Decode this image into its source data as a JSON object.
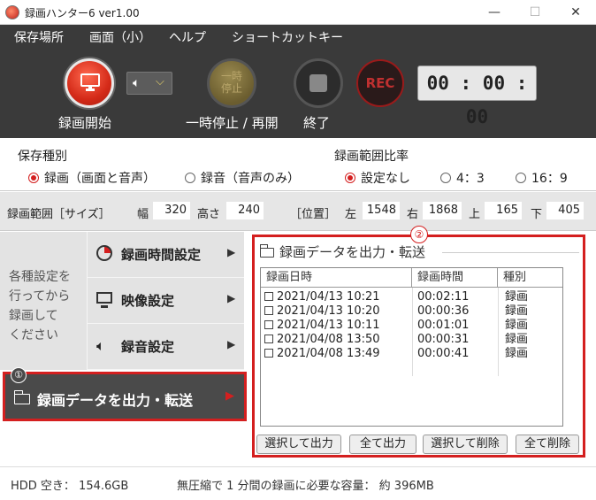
{
  "window": {
    "title": "録画ハンター6 ver1.00",
    "minimize": "—",
    "maximize": "☐",
    "close": "✕"
  },
  "menu": [
    "保存場所",
    "画面（小）",
    "ヘルプ",
    "ショートカットキー"
  ],
  "toolbar": {
    "rec_start_label": "録画開始",
    "pause_button_text": "一時\n停止",
    "pause_label": "一時停止 / 再開",
    "stop_label": "終了",
    "rec_badge": "REC",
    "timer": "00 : 00 : 00",
    "audio_icon": "speaker-icon",
    "accent_color": "#d41f1f"
  },
  "save_type": {
    "title": "保存種別",
    "options": [
      "録画（画面と音声）",
      "録音（音声のみ）"
    ],
    "selected": 0
  },
  "ratio": {
    "title": "録画範囲比率",
    "options": [
      "設定なし",
      "4：3",
      "16：9"
    ],
    "selected": 0
  },
  "range": {
    "label": "録画範囲［サイズ］",
    "width_label": "幅",
    "width": "320",
    "height_label": "高さ",
    "height": "240",
    "position_label": "［位置］",
    "left_label": "左",
    "left": "1548",
    "right_label": "右",
    "right": "1868",
    "top_label": "上",
    "top": "165",
    "bottom_label": "下",
    "bottom": "405"
  },
  "left_info": "各種設定を\n行ってから\n録画して\nください",
  "nav": {
    "time": "録画時間設定",
    "video": "映像設定",
    "audio": "録音設定",
    "export": "録画データを出力・転送",
    "badge1": "①"
  },
  "panel": {
    "badge2": "②",
    "title": "録画データを出力・転送",
    "columns": [
      "録画日時",
      "録画時間",
      "種別"
    ],
    "rows": [
      {
        "date": "2021/04/13 10:21",
        "duration": "00:02:11",
        "kind": "録画"
      },
      {
        "date": "2021/04/13 10:20",
        "duration": "00:00:36",
        "kind": "録画"
      },
      {
        "date": "2021/04/13 10:11",
        "duration": "00:01:01",
        "kind": "録画"
      },
      {
        "date": "2021/04/08 13:50",
        "duration": "00:00:31",
        "kind": "録画"
      },
      {
        "date": "2021/04/08 13:49",
        "duration": "00:00:41",
        "kind": "録画"
      }
    ],
    "buttons": [
      "選択して出力",
      "全て出力",
      "選択して削除",
      "全て削除"
    ]
  },
  "status": {
    "hdd": "HDD 空き： 154.6GB",
    "capacity": "無圧縮で 1 分間の録画に必要な容量： 約 396MB"
  }
}
